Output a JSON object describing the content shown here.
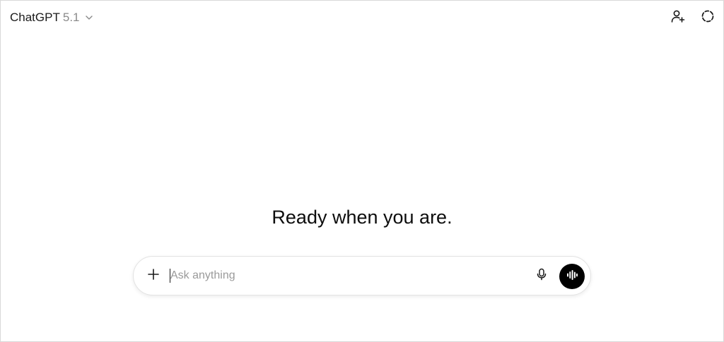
{
  "header": {
    "model_name": "ChatGPT",
    "model_version": "5.1",
    "icons": {
      "model_dropdown": "chevron-down-icon",
      "add_people": "add-person-icon",
      "temporary_chat": "dashed-circle-icon"
    }
  },
  "main": {
    "headline": "Ready when you are."
  },
  "composer": {
    "placeholder": "Ask anything",
    "value": "",
    "icons": {
      "attach": "plus-icon",
      "dictate": "microphone-icon",
      "voice_mode": "voice-waveform-icon"
    }
  },
  "colors": {
    "text": "#0d0d0d",
    "muted": "#8a8a8a",
    "voice_button": "#000000",
    "border": "#e3e3e3"
  }
}
